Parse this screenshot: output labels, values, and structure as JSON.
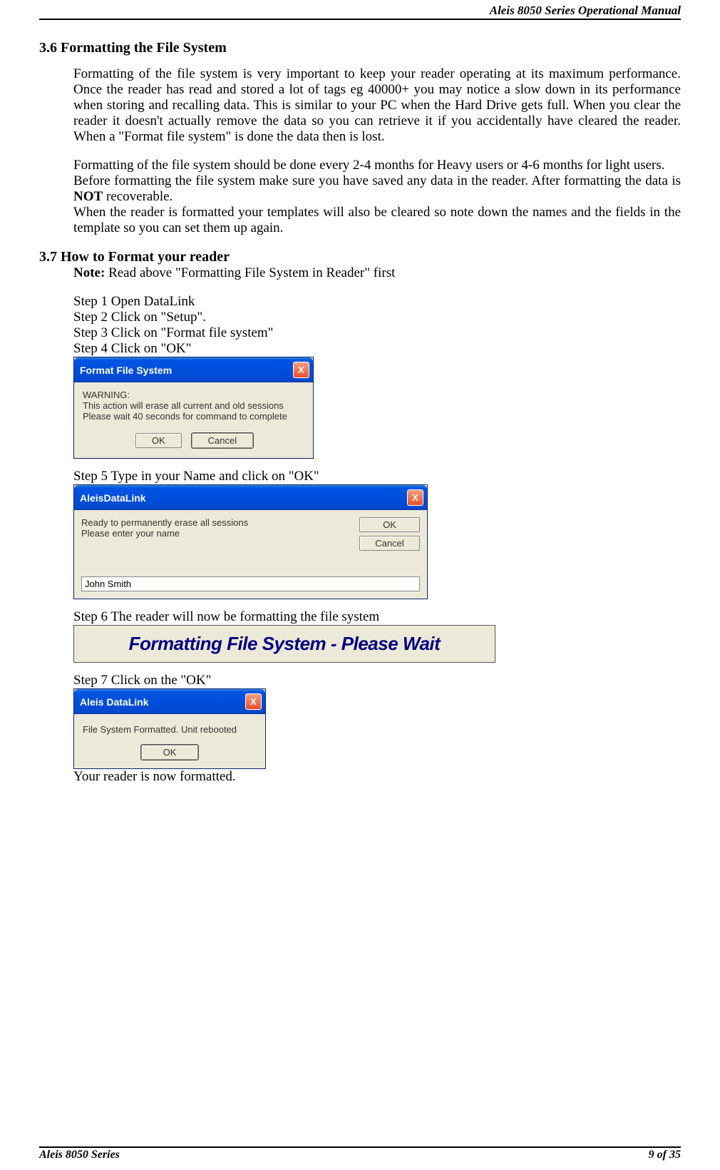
{
  "header": {
    "title": "Aleis 8050 Series Operational Manual"
  },
  "section36": {
    "num": "3.6",
    "title": "Formatting the File System",
    "para1": "Formatting of the file system is very important to keep your reader operating at its maximum performance. Once the reader has read and stored a lot of tags eg 40000+ you may notice a slow down in its performance when storing and recalling data. This is similar to your PC when the Hard Drive gets full. When you clear the reader it doesn't actually remove the data so you can retrieve it if you accidentally have cleared  the reader. When a \"Format file system\" is done the data then is lost.",
    "para2": "Formatting of the file system should be done every 2-4 months for Heavy users or 4-6 months for light users.",
    "para3a": "Before formatting the file system make sure you have saved any data in the reader. After formatting the data is ",
    "para3b": "NOT",
    "para3c": " recoverable.",
    "para4": "When the reader is formatted your templates will also be cleared so note down the names and the fields in the template so you can set them up again."
  },
  "section37": {
    "num": "3.7",
    "title": "How to Format your reader",
    "noteLabel": "Note:",
    "noteText": " Read above \"Formatting File System in Reader\" first",
    "step1": "Step 1 Open DataLink",
    "step2": "Step 2 Click on \"Setup\".",
    "step3": "Step 3 Click on \"Format file system\"",
    "step4": "Step 4 Click on \"OK\"",
    "step5": "Step 5 Type in your Name and click on \"OK\"",
    "step6": "Step 6 The reader will now be formatting the file system",
    "step7": "Step 7 Click on the \"OK\"",
    "final": "Your reader is now formatted."
  },
  "dialog1": {
    "title": "Format File System",
    "warning": "WARNING:",
    "line1": "This action will erase all current and old sessions",
    "line2": "Please wait 40 seconds for command to complete",
    "ok": "OK",
    "cancel": "Cancel",
    "close": "X"
  },
  "dialog2": {
    "title": "AleisDataLink",
    "line1": "Ready to permanently erase all sessions",
    "line2": "Please enter your name",
    "ok": "OK",
    "cancel": "Cancel",
    "input": "John Smith",
    "close": "X"
  },
  "dialog3": {
    "text": "Formatting File System - Please Wait"
  },
  "dialog4": {
    "title": "Aleis DataLink",
    "msg": "File System Formatted. Unit rebooted",
    "ok": "OK",
    "close": "X"
  },
  "footer": {
    "left": "Aleis 8050 Series",
    "right": "9 of 35"
  }
}
